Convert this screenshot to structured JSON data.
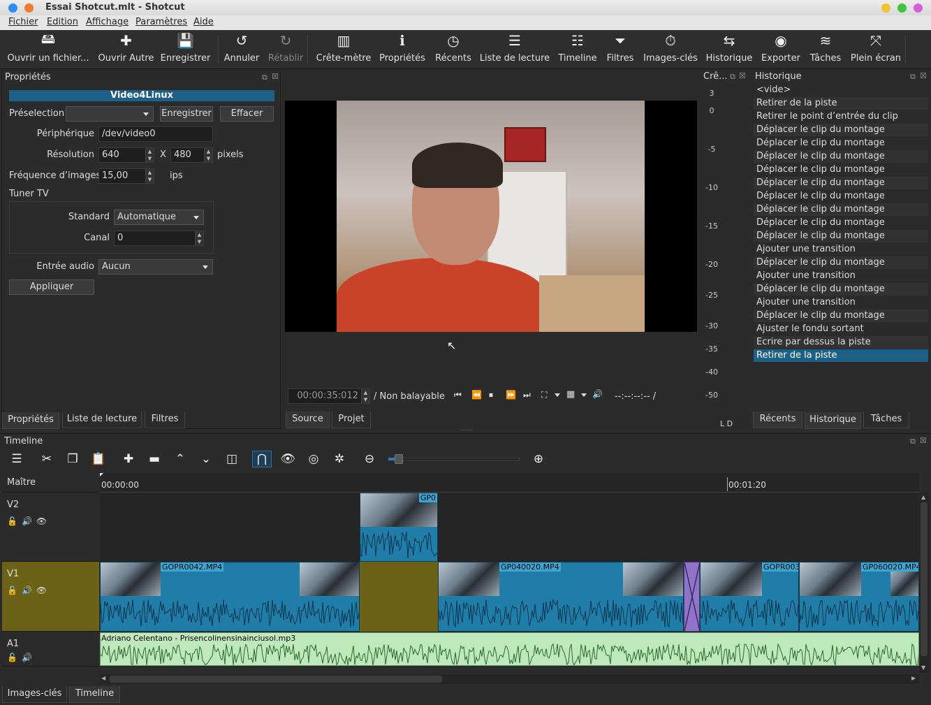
{
  "window": {
    "title": "Essai Shotcut.mlt - Shotcut"
  },
  "menu": [
    "Fichier",
    "Edition",
    "Affichage",
    "Paramètres",
    "Aide"
  ],
  "toolbar": [
    {
      "label": "Ouvrir un fichier...",
      "icon": "open-file-icon",
      "glyph": "🖴"
    },
    {
      "label": "Ouvrir Autre",
      "icon": "open-other-icon",
      "glyph": "✚"
    },
    {
      "label": "Enregistrer",
      "icon": "save-icon",
      "glyph": "💾"
    },
    {
      "label": "Annuler",
      "icon": "undo-icon",
      "glyph": "↺"
    },
    {
      "label": "Rétablir",
      "icon": "redo-icon",
      "glyph": "↻"
    },
    {
      "label": "Crête-mètre",
      "icon": "peak-meter-icon",
      "glyph": "▥"
    },
    {
      "label": "Propriétés",
      "icon": "info-icon",
      "glyph": "ℹ"
    },
    {
      "label": "Récents",
      "icon": "clock-icon",
      "glyph": "◷"
    },
    {
      "label": "Liste de lecture",
      "icon": "list-icon",
      "glyph": "☰"
    },
    {
      "label": "Timeline",
      "icon": "timeline-icon",
      "glyph": "☷"
    },
    {
      "label": "Filtres",
      "icon": "filter-icon",
      "glyph": "⏷"
    },
    {
      "label": "Images-clés",
      "icon": "stopwatch-icon",
      "glyph": "⏱"
    },
    {
      "label": "Historique",
      "icon": "history-icon",
      "glyph": "⇆"
    },
    {
      "label": "Exporter",
      "icon": "export-icon",
      "glyph": "◉"
    },
    {
      "label": "Tâches",
      "icon": "jobs-icon",
      "glyph": "≋"
    },
    {
      "label": "Plein écran",
      "icon": "fullscreen-icon",
      "glyph": "⤧"
    }
  ],
  "properties": {
    "dock_title": "Propriétés",
    "header": "Video4Linux",
    "preset_label": "Préselection",
    "preset_value": "",
    "save_btn": "Enregistrer",
    "clear_btn": "Effacer",
    "device_label": "Périphérique",
    "device_value": "/dev/video0",
    "resolution_label": "Résolution",
    "res_w": "640",
    "res_x": "X",
    "res_h": "480",
    "res_unit": "pixels",
    "fps_label": "Fréquence d’images",
    "fps_value": "15,00",
    "fps_unit": "ips",
    "tuner_label": "Tuner TV",
    "standard_label": "Standard",
    "standard_value": "Automatique",
    "channel_label": "Canal",
    "channel_value": "0",
    "audio_label": "Entrée audio",
    "audio_value": "Aucun",
    "apply_btn": "Appliquer",
    "tabs": [
      "Propriétés",
      "Liste de lecture",
      "Filtres"
    ]
  },
  "player": {
    "timecode": "00:00:35:012",
    "duration": "/ Non balayable",
    "readout": "--:--:--:-- /",
    "tabs": [
      "Source",
      "Projet"
    ]
  },
  "meter": {
    "title": "Crê...",
    "scale": [
      "3",
      "0",
      "-5",
      "-10",
      "-15",
      "-20",
      "-25",
      "-30",
      "-35",
      "-40",
      "-50"
    ],
    "channels": "L D"
  },
  "history": {
    "title": "Historique",
    "items": [
      "<vide>",
      "Retirer de la piste",
      "Retirer le point d’entrée du clip",
      "Déplacer le clip du montage",
      "Déplacer le clip du montage",
      "Déplacer le clip du montage",
      "Déplacer le clip du montage",
      "Déplacer le clip du montage",
      "Déplacer le clip du montage",
      "Déplacer le clip du montage",
      "Déplacer le clip du montage",
      "Déplacer le clip du montage",
      "Ajouter une transition",
      "Déplacer le clip du montage",
      "Ajouter une transition",
      "Déplacer le clip du montage",
      "Ajouter une transition",
      "Déplacer le clip du montage",
      "Ajuster le fondu sortant",
      "Ecrire par dessus la piste",
      "Retirer de la piste"
    ],
    "selected": 20,
    "tabs": [
      "Récents",
      "Historique",
      "Tâches"
    ]
  },
  "timeline": {
    "title": "Timeline",
    "ruler": [
      "00:00:00",
      "00:01:20"
    ],
    "tracks": {
      "master": "Maître",
      "v2": "V2",
      "v1": "V1",
      "a1": "A1"
    },
    "clips": {
      "v2": "GP0",
      "c1": "GOPR0042.MP4",
      "c2": "GP040020.MP4",
      "c3": "GOPR003",
      "c4": "GP060020.MP4",
      "a1": "Adriano Celentano - Prisencolinensinainciusol.mp3"
    },
    "zoom": 0.05
  },
  "bottom_tabs": [
    "Images-clés",
    "Timeline"
  ]
}
